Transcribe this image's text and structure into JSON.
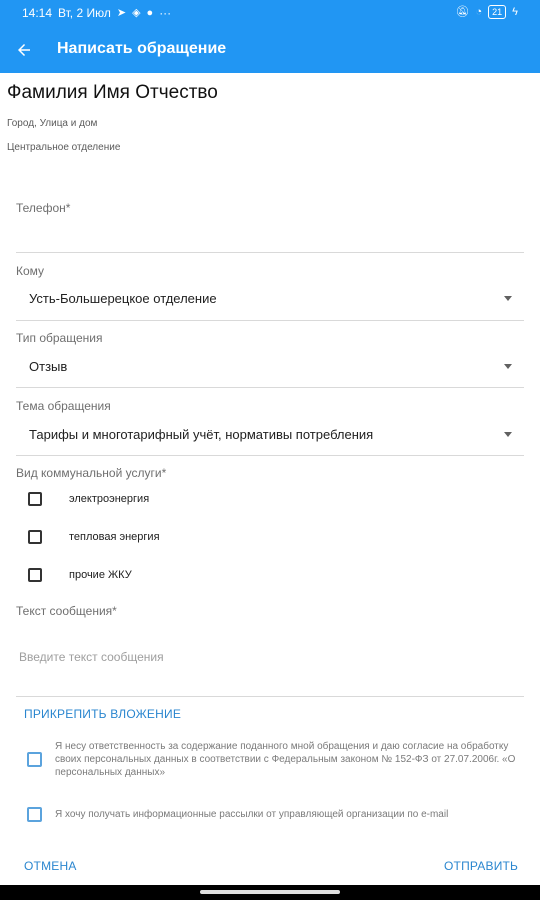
{
  "status_bar": {
    "time": "14:14",
    "date": "Вт, 2 Июл",
    "extra": "···",
    "battery": "21"
  },
  "app_bar": {
    "title": "Написать обращение"
  },
  "profile": {
    "name": "Фамилия Имя Отчество",
    "address": "Город, Улица и дом",
    "department": "Центральное отделение"
  },
  "form": {
    "phone": {
      "label": "Телефон*",
      "value": ""
    },
    "recipient": {
      "label": "Кому",
      "value": "Усть-Большерецкое отделение"
    },
    "appeal_type": {
      "label": "Тип обращения",
      "value": "Отзыв"
    },
    "appeal_topic": {
      "label": "Тема обращения",
      "value": "Тарифы и многотарифный учёт, нормативы потребления"
    },
    "service_type": {
      "label": "Вид коммунальной услуги*",
      "options": [
        {
          "label": "электроэнергия",
          "checked": false
        },
        {
          "label": "тепловая энергия",
          "checked": false
        },
        {
          "label": "прочие ЖКУ",
          "checked": false
        }
      ]
    },
    "message": {
      "label": "Текст сообщения*",
      "placeholder": "Введите текст сообщения"
    },
    "attach_label": "ПРИКРЕПИТЬ ВЛОЖЕНИЕ",
    "consent": {
      "text": "Я несу ответственность за содержание поданного мной обращения и даю согласие на обработку своих персональных данных в соответствии с Федеральным законом № 152-ФЗ от 27.07.2006г. «О персональных данных»",
      "checked": false
    },
    "newsletter": {
      "text": "Я хочу получать информационные рассылки от управляющей организации по e-mail",
      "checked": false
    }
  },
  "footer": {
    "cancel_label": "ОТМЕНА",
    "send_label": "ОТПРАВИТЬ"
  },
  "colors": {
    "primary": "#2196f3",
    "accent_text": "#2a86cf"
  }
}
